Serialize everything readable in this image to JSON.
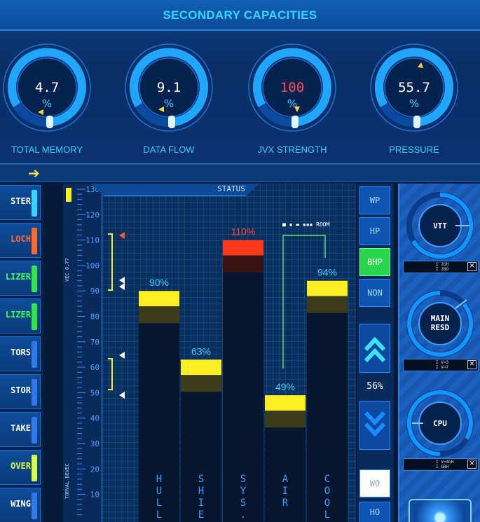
{
  "header": {
    "title": "SECONDARY CAPACITIES"
  },
  "gauges": [
    {
      "value": "4.7",
      "unit": "%",
      "label": "TOTAL MEMORY"
    },
    {
      "value": "9.1",
      "unit": "%",
      "label": "DATA FLOW"
    },
    {
      "value": "100",
      "unit": "%",
      "label": "JVX STRENGTH",
      "value_color": "#ff4d5a"
    },
    {
      "value": "55.7",
      "unit": "%",
      "label": "PRESSURE"
    }
  ],
  "left_list": [
    {
      "label": "STER",
      "color": "#ffffff",
      "swatch": "#33d6ff"
    },
    {
      "label": "LOCH",
      "color": "#ff6a3a",
      "swatch": "#ff6a2a"
    },
    {
      "label": "LIZER",
      "color": "#3cff5a",
      "swatch": "#2ee84a"
    },
    {
      "label": "LIZER",
      "color": "#3cff5a",
      "swatch": "#2ee84a"
    },
    {
      "label": "TORS",
      "color": "#ffffff",
      "swatch": "#2f7ae8"
    },
    {
      "label": "STOR",
      "color": "#ffffff",
      "swatch": "#2f7ae8"
    },
    {
      "label": "TAKE",
      "color": "#ffffff",
      "swatch": "#2f7ae8"
    },
    {
      "label": "OVER",
      "color": "#d8ff40",
      "swatch": "#d8ff40"
    },
    {
      "label": "WING",
      "color": "#ffffff",
      "swatch": "#2f7ae8"
    }
  ],
  "ruler": {
    "ticks": [
      "130",
      "120",
      "110",
      "100",
      "90",
      "80",
      "70",
      "60",
      "50",
      "40",
      "30",
      "20",
      "10"
    ],
    "side_text_top": "VEC 0.77",
    "side_text_bottom": "TORVAL DEVEC"
  },
  "status": {
    "label": "STATUS",
    "legend": "■ ▪ ▬ ▪▪▪ ROOM"
  },
  "chart_data": {
    "type": "bar",
    "title": "STATUS",
    "categories": [
      "HULL",
      "SHIELD",
      "SYS.",
      "AIR",
      "COOL"
    ],
    "values": [
      90,
      63,
      110,
      49,
      94
    ],
    "value_labels": [
      "90%",
      "63%",
      "110%",
      "49%",
      "94%"
    ],
    "ylim": [
      0,
      130
    ],
    "colors": {
      "normal": "#ffee22",
      "overload": "#ff3a1a"
    }
  },
  "right_buttons": [
    {
      "label": "WP",
      "active": false
    },
    {
      "label": "HP",
      "active": false
    },
    {
      "label": "BHP",
      "active": true
    },
    {
      "label": "NON",
      "active": false
    }
  ],
  "scroll": {
    "percent": "56%"
  },
  "bottom_buttons": [
    {
      "label": "WO"
    },
    {
      "label": "HO"
    }
  ],
  "right_gauges": [
    {
      "label": "VTT",
      "info": "I 2GH\nI 2BO"
    },
    {
      "label": "MAIN\nRESD",
      "info": "I V=3\nI V=7"
    },
    {
      "label": "CPU",
      "info": "I V=4GH\nI GBH"
    }
  ]
}
